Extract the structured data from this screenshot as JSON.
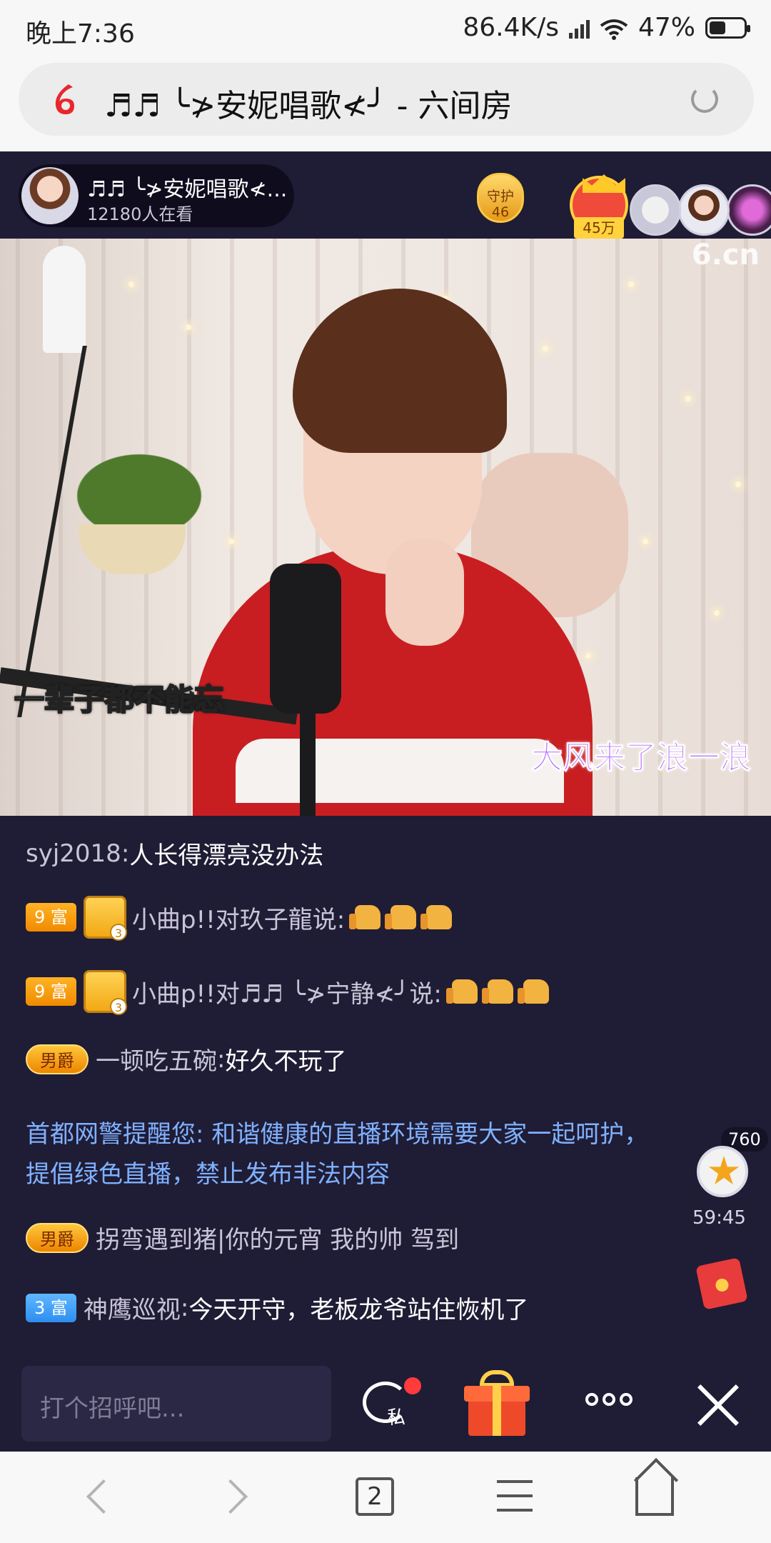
{
  "status_bar": {
    "time": "晚上7:36",
    "net_speed": "86.4K/s",
    "battery": "47%",
    "battery_level": 0.47
  },
  "browser": {
    "page_title": "♬♬ ╰≯安妮唱歌≮╯ - 六间房"
  },
  "room": {
    "host_name": "♬♬ ╰≯安妮唱歌≮...",
    "viewers": "12180人在看",
    "guard_label": "守护",
    "guard_count": "46",
    "top_contrib": "45万",
    "watermark": "6.cn",
    "subtitle_left": "一辈子都不能忘",
    "subtitle_right": "大风来了浪一浪"
  },
  "chat": {
    "messages": [
      {
        "user": "syj2018",
        "sep": ":",
        "text": " 人长得漂亮没办法"
      },
      {
        "badge": "9 富",
        "level": "3",
        "user": "小曲p!!对",
        "target": "玖子龍",
        "text": "说:"
      },
      {
        "badge": "9 富",
        "level": "3",
        "user": "小曲p!!对",
        "target": "♬♬ ╰≯宁静≮╯",
        "text": " 说:"
      },
      {
        "noble": "男爵",
        "user": "一顿吃五碗",
        "sep": ":",
        "text": " 好久不玩了"
      },
      {
        "noble": "男爵",
        "user": "拐弯遇到猪|你的元宵 我的帅 驾到",
        "text": ""
      },
      {
        "badge": "3 富",
        "user": "神鹰巡视",
        "sep": ":",
        "text": " 今天开守，老板龙爷站住恢机了"
      }
    ],
    "system_notice": "首都网警提醒您: 和谐健康的直播环境需要大家一起呵护，提倡绿色直播，禁止发布非法内容"
  },
  "floats": {
    "star_count": "760",
    "star_timer": "59:45"
  },
  "bottom_bar": {
    "input_placeholder": "打个招呼吧...",
    "private_label": "私"
  },
  "nav": {
    "tab_count": "2"
  },
  "colors": {
    "stage_bg": "#1f1c35",
    "system_notice": "#7fb1ff",
    "rich_gold": "#f08a00",
    "rich_blue": "#2d8ef0"
  }
}
